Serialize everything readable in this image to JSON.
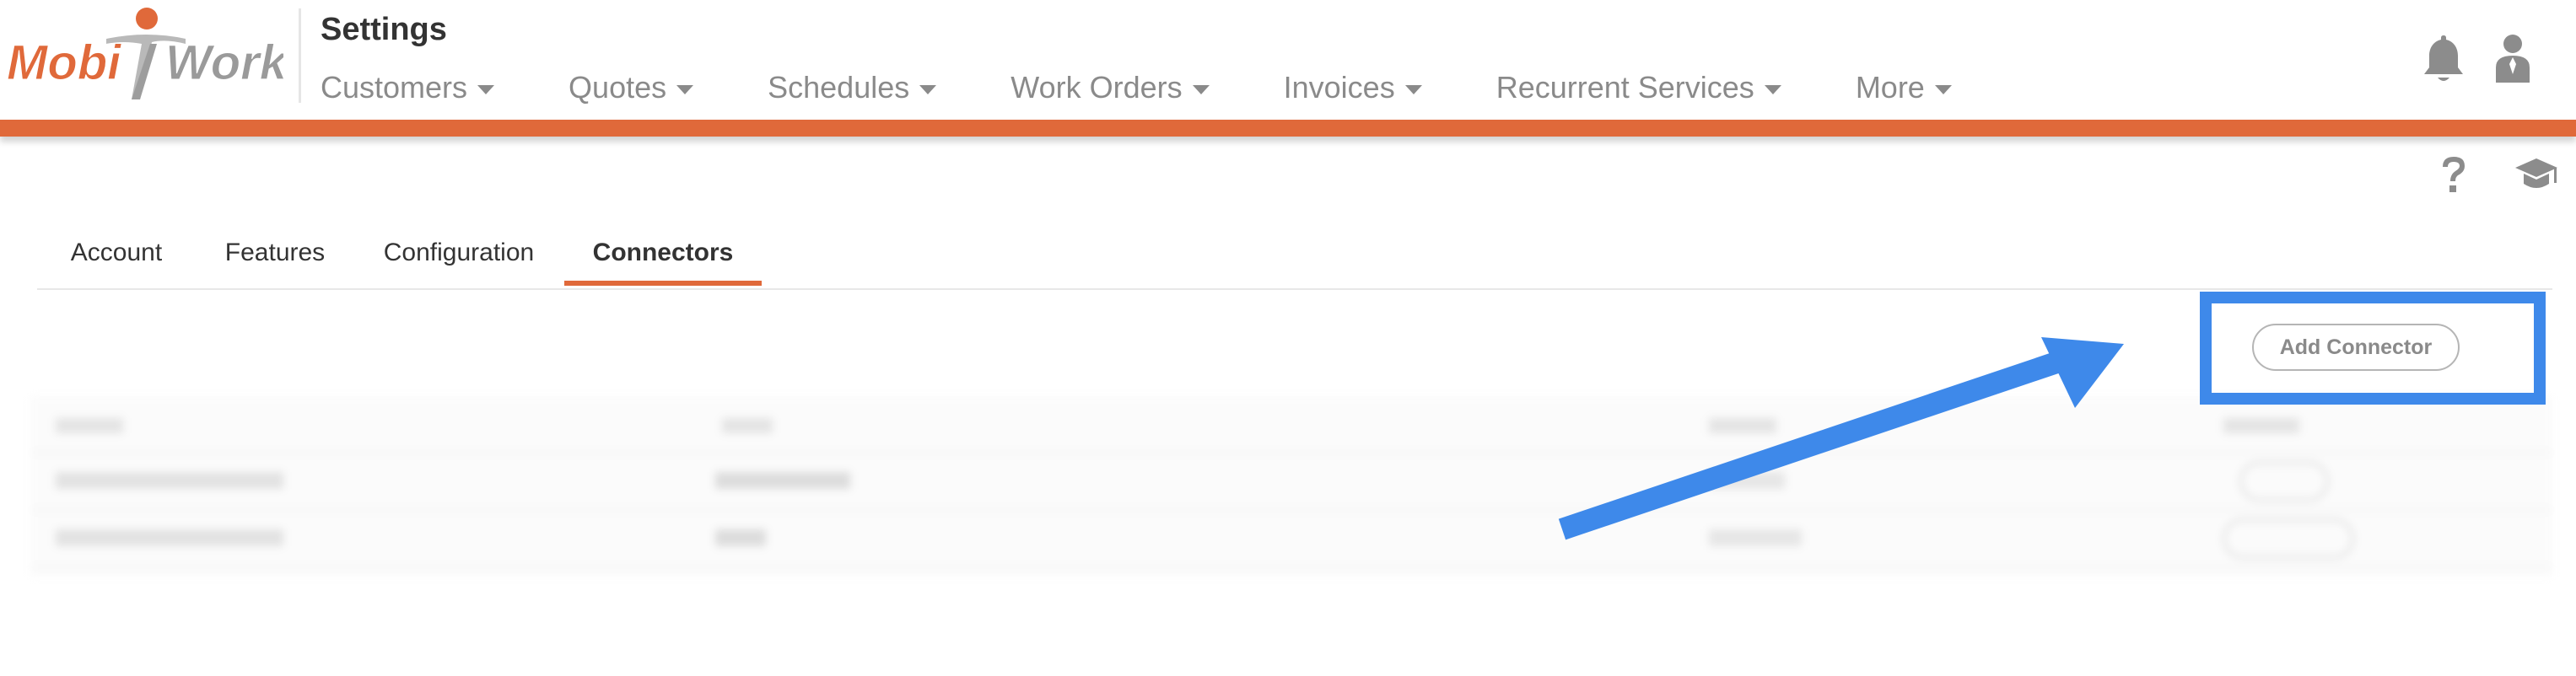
{
  "app": {
    "brand": "MobiWork",
    "brand_parts": [
      "Mobi",
      "Work"
    ],
    "page_title": "Settings"
  },
  "nav": {
    "items": [
      {
        "label": "Customers"
      },
      {
        "label": "Quotes"
      },
      {
        "label": "Schedules"
      },
      {
        "label": "Work Orders"
      },
      {
        "label": "Invoices"
      },
      {
        "label": "Recurrent Services"
      },
      {
        "label": "More"
      }
    ]
  },
  "header_icons": {
    "notifications": "bell-icon",
    "user": "user-icon",
    "help": "question-icon",
    "training": "graduation-cap-icon"
  },
  "tabs": [
    {
      "label": "Account",
      "active": false
    },
    {
      "label": "Features",
      "active": false
    },
    {
      "label": "Configuration",
      "active": false
    },
    {
      "label": "Connectors",
      "active": true
    }
  ],
  "connectors": {
    "add_button_label": "Add Connector"
  },
  "colors": {
    "brand_orange": "#e0693a",
    "annotation_blue": "#3e89ea",
    "nav_text": "#8a8a8a"
  }
}
